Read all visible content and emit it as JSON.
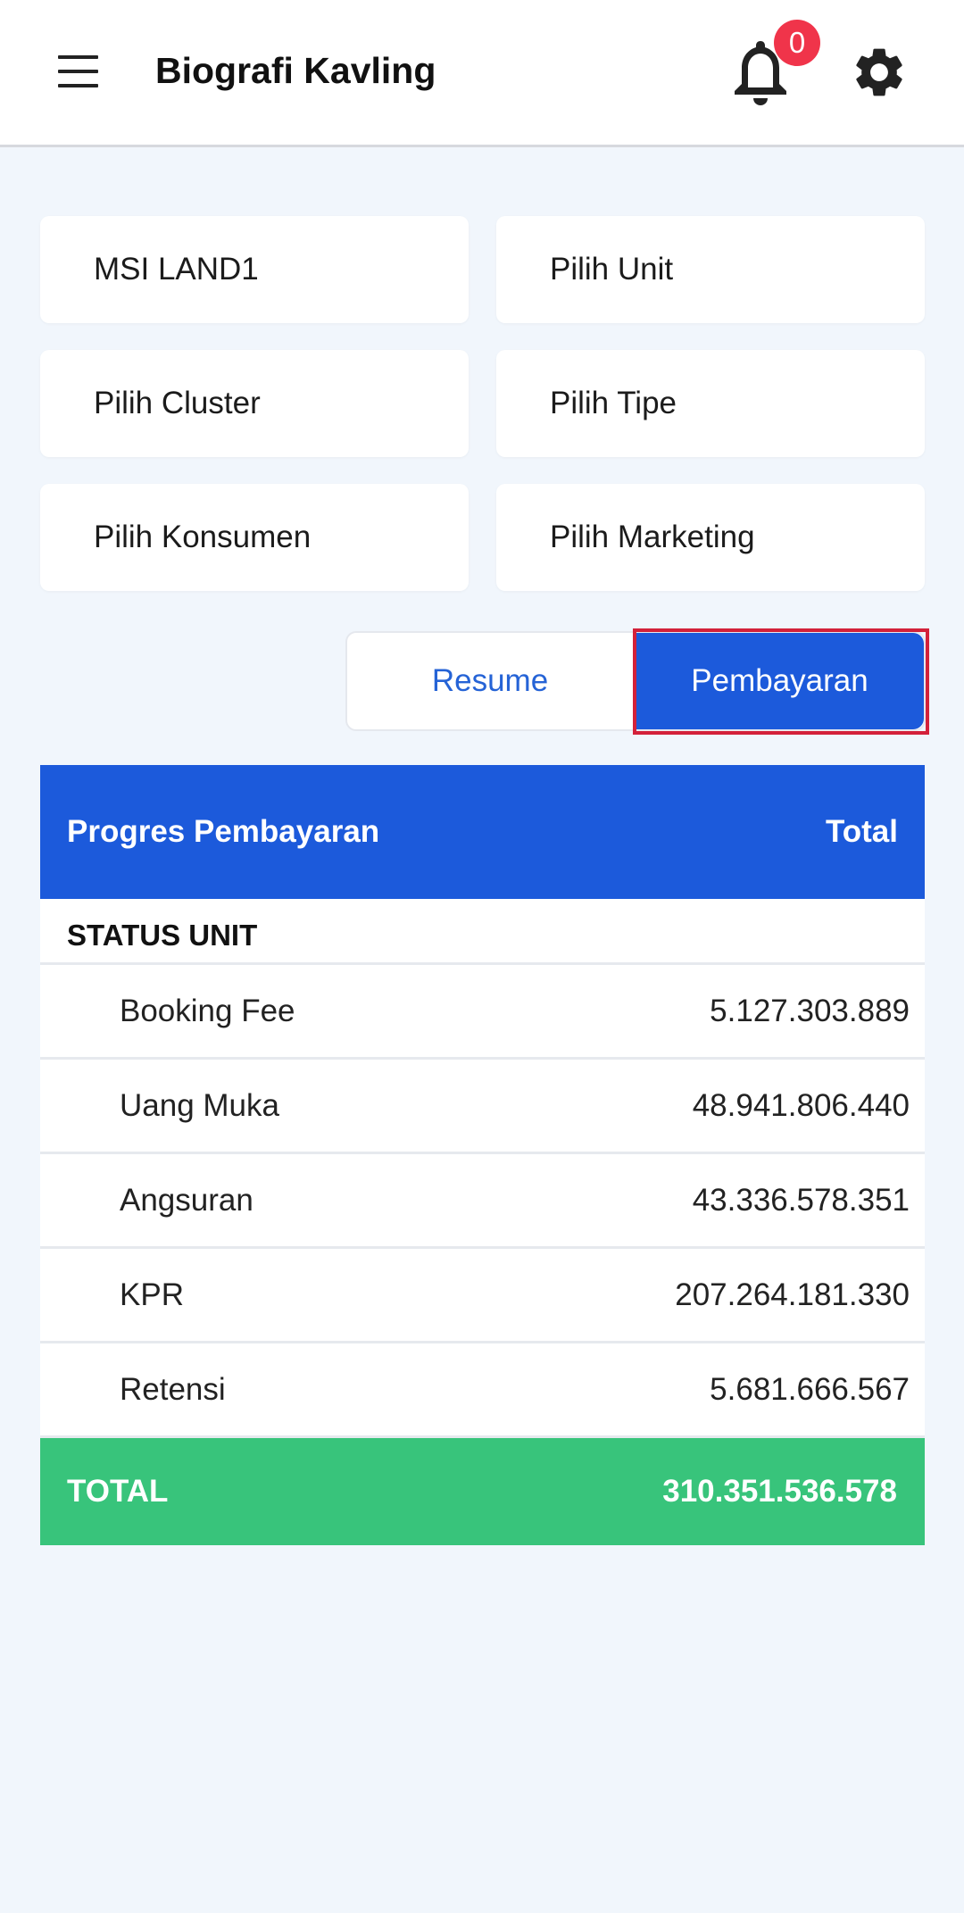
{
  "appbar": {
    "title": "Biografi Kavling",
    "notification_count": "0",
    "icons": [
      "menu-icon",
      "bell-icon",
      "gear-icon"
    ]
  },
  "filters": {
    "company": "MSI LAND1",
    "unit": "Pilih Unit",
    "cluster": "Pilih Cluster",
    "type": "Pilih Tipe",
    "consumer": "Pilih Konsumen",
    "marketing": "Pilih Marketing"
  },
  "segments": {
    "resume": "Resume",
    "payment": "Pembayaran",
    "selected": "payment"
  },
  "table": {
    "header_left": "Progres Pembayaran",
    "header_right": "Total",
    "section": "STATUS UNIT",
    "rows": [
      {
        "label": "Booking Fee",
        "value": "5.127.303.889"
      },
      {
        "label": "Uang Muka",
        "value": "48.941.806.440"
      },
      {
        "label": "Angsuran",
        "value": "43.336.578.351"
      },
      {
        "label": "KPR",
        "value": "207.264.181.330"
      },
      {
        "label": "Retensi",
        "value": "5.681.666.567"
      }
    ],
    "total_label": "TOTAL",
    "total_value": "310.351.536.578"
  },
  "colors": {
    "primary": "#1c5adb",
    "total_green": "#38c47b",
    "badge_red": "#f0344a",
    "background": "#f1f6fc"
  }
}
